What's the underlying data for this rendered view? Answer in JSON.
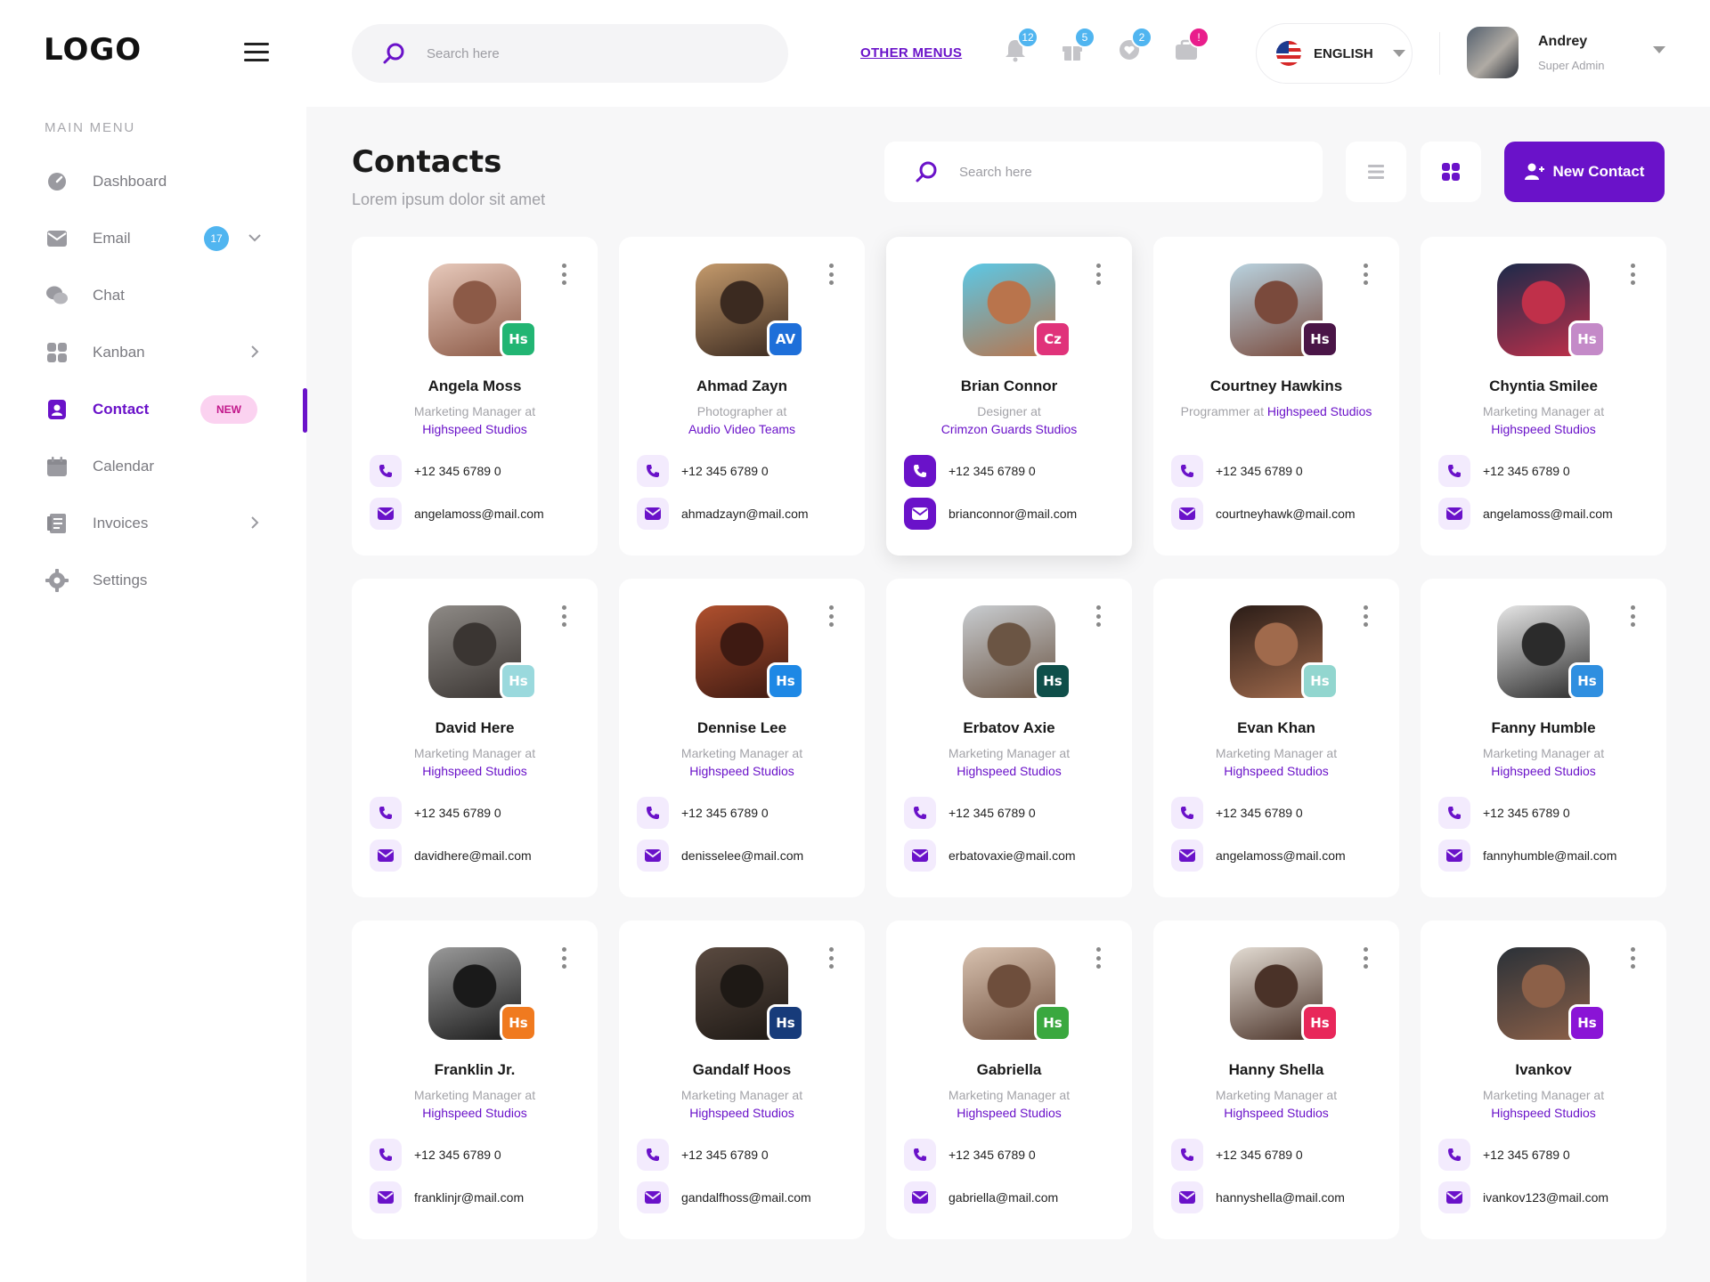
{
  "sidebar": {
    "logo": "LOGO",
    "menu_title": "MAIN MENU",
    "items": [
      {
        "key": "dashboard",
        "label": "Dashboard",
        "icon": "dashboard-gauge-icon"
      },
      {
        "key": "email",
        "label": "Email",
        "icon": "envelope-icon",
        "badge": "17",
        "has_caret": "down"
      },
      {
        "key": "chat",
        "label": "Chat",
        "icon": "chat-bubbles-icon"
      },
      {
        "key": "kanban",
        "label": "Kanban",
        "icon": "kanban-grid-icon",
        "has_caret": "right"
      },
      {
        "key": "contact",
        "label": "Contact",
        "icon": "contact-book-icon",
        "badge_new": "NEW",
        "active": true
      },
      {
        "key": "calendar",
        "label": "Calendar",
        "icon": "calendar-icon"
      },
      {
        "key": "invoices",
        "label": "Invoices",
        "icon": "invoice-icon",
        "has_caret": "right"
      },
      {
        "key": "settings",
        "label": "Settings",
        "icon": "gear-icon"
      }
    ]
  },
  "topbar": {
    "search_placeholder": "Search here",
    "other_menus": "OTHER MENUS",
    "notifications": [
      {
        "icon": "bell-icon",
        "count": "12",
        "color": "#50b5f0"
      },
      {
        "icon": "gift-icon",
        "count": "5",
        "color": "#50b5f0"
      },
      {
        "icon": "heart-bubble-icon",
        "count": "2",
        "color": "#50b5f0"
      },
      {
        "icon": "briefcase-icon",
        "count": "!",
        "color": "#e91e8c"
      }
    ],
    "language": "ENGLISH",
    "user": {
      "name": "Andrey",
      "role": "Super Admin"
    }
  },
  "page": {
    "title": "Contacts",
    "subtitle": "Lorem ipsum  dolor sit amet",
    "search_placeholder": "Search here",
    "new_button": "New Contact"
  },
  "colors": {
    "accent": "#6a12c9",
    "badge_blue": "#50b5f0",
    "badge_pink": "#e91e8c"
  },
  "contacts": [
    {
      "name": "Angela Moss",
      "role": "Marketing Manager at",
      "company": "Highspeed Studios",
      "phone": "+12 345 6789 0",
      "email": "angelamoss@mail.com",
      "tag": "Hs",
      "tag_color": "#22b573",
      "photo": [
        "#e7c9bb",
        "#8c5a47"
      ]
    },
    {
      "name": "Ahmad Zayn",
      "role": "Photographer at",
      "company": "Audio Video Teams",
      "phone": "+12 345 6789 0",
      "email": "ahmadzayn@mail.com",
      "tag": "AV",
      "tag_color": "#1e6fd9",
      "photo": [
        "#c49a6c",
        "#3b2a20"
      ]
    },
    {
      "name": "Brian Connor",
      "role": "Designer at",
      "company": "Crimzon Guards Studios",
      "phone": "+12 345 6789 0",
      "email": "brianconnor@mail.com",
      "tag": "Cz",
      "tag_color": "#e0337a",
      "photo": [
        "#5bc8e6",
        "#b9744c"
      ],
      "highlight": true
    },
    {
      "name": "Courtney Hawkins",
      "role": "Programmer at",
      "company": "Highspeed Studios",
      "phone": "+12 345 6789 0",
      "email": "courtneyhawk@mail.com",
      "tag": "Hs",
      "tag_color": "#4a1547",
      "photo": [
        "#b9d3e0",
        "#7a4a3c"
      ]
    },
    {
      "name": "Chyntia Smilee",
      "role": "Marketing Manager at",
      "company": "Highspeed Studios",
      "phone": "+12 345 6789 0",
      "email": "angelamoss@mail.com",
      "tag": "Hs",
      "tag_color": "#c48ac8",
      "photo": [
        "#1b2a4a",
        "#c0304a"
      ]
    },
    {
      "name": "David Here",
      "role": "Marketing Manager at",
      "company": "Highspeed Studios",
      "phone": "+12 345 6789 0",
      "email": "davidhere@mail.com",
      "tag": "Hs",
      "tag_color": "#9ad9dd",
      "photo": [
        "#8e8a86",
        "#3a3532"
      ]
    },
    {
      "name": "Dennise Lee",
      "role": "Marketing Manager at",
      "company": "Highspeed Studios",
      "phone": "+12 345 6789 0",
      "email": "denisselee@mail.com",
      "tag": "Hs",
      "tag_color": "#1e88e5",
      "photo": [
        "#b0502e",
        "#3e1a12"
      ]
    },
    {
      "name": "Erbatov Axie",
      "role": "Marketing Manager at",
      "company": "Highspeed Studios",
      "phone": "+12 345 6789 0",
      "email": "erbatovaxie@mail.com",
      "tag": "Hs",
      "tag_color": "#0f4f4a",
      "photo": [
        "#c9cdd1",
        "#6b5544"
      ]
    },
    {
      "name": "Evan Khan",
      "role": "Marketing Manager at",
      "company": "Highspeed Studios",
      "phone": "+12 345 6789 0",
      "email": "angelamoss@mail.com",
      "tag": "Hs",
      "tag_color": "#92d6cf",
      "photo": [
        "#2a1c17",
        "#a06a4c"
      ]
    },
    {
      "name": "Fanny Humble",
      "role": "Marketing Manager at",
      "company": "Highspeed Studios",
      "phone": "+12 345 6789 0",
      "email": "fannyhumble@mail.com",
      "tag": "Hs",
      "tag_color": "#2f8fe0",
      "photo": [
        "#e6e6e6",
        "#2b2b2b"
      ]
    },
    {
      "name": "Franklin Jr.",
      "role": "Marketing Manager at",
      "company": "Highspeed Studios",
      "phone": "+12 345 6789 0",
      "email": "franklinjr@mail.com",
      "tag": "Hs",
      "tag_color": "#f07a1f",
      "photo": [
        "#9a9a9a",
        "#1a1a1a"
      ]
    },
    {
      "name": "Gandalf Hoos",
      "role": "Marketing Manager at",
      "company": "Highspeed Studios",
      "phone": "+12 345 6789 0",
      "email": "gandalfhoss@mail.com",
      "tag": "Hs",
      "tag_color": "#173b7a",
      "photo": [
        "#5a4a40",
        "#1e1915"
      ]
    },
    {
      "name": "Gabriella",
      "role": "Marketing Manager at",
      "company": "Highspeed Studios",
      "phone": "+12 345 6789 0",
      "email": "gabriella@mail.com",
      "tag": "Hs",
      "tag_color": "#3aa83f",
      "photo": [
        "#d8c2b0",
        "#6e4e3c"
      ]
    },
    {
      "name": "Hanny Shella",
      "role": "Marketing Manager at",
      "company": "Highspeed Studios",
      "phone": "+12 345 6789 0",
      "email": "hannyshella@mail.com",
      "tag": "Hs",
      "tag_color": "#e8275a",
      "photo": [
        "#e3dcd3",
        "#4a3228"
      ]
    },
    {
      "name": "Ivankov",
      "role": "Marketing Manager at",
      "company": "Highspeed Studios",
      "phone": "+12 345 6789 0",
      "email": "ivankov123@mail.com",
      "tag": "Hs",
      "tag_color": "#8a14d6",
      "photo": [
        "#2a3138",
        "#8c6048"
      ]
    }
  ]
}
